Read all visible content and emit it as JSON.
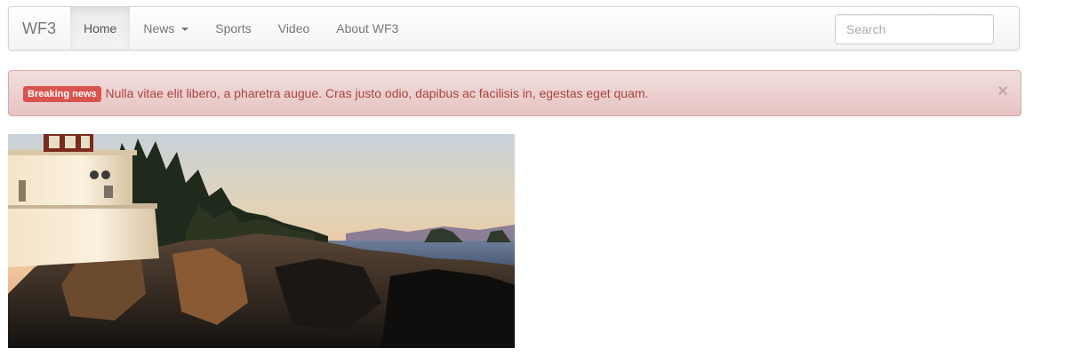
{
  "navbar": {
    "brand": "WF3",
    "items": [
      {
        "label": "Home",
        "active": true
      },
      {
        "label": "News",
        "dropdown": true
      },
      {
        "label": "Sports"
      },
      {
        "label": "Video"
      },
      {
        "label": "About WF3"
      }
    ],
    "search": {
      "placeholder": "Search",
      "value": ""
    }
  },
  "alert": {
    "badge": "Breaking news",
    "message": "Nulla vitae elit libero, a pharetra augue. Cras justo odio, dapibus ac facilisis in, egestas eget quam.",
    "close": "×"
  },
  "hero_image": {
    "subject": "lighthouse-on-rocky-coast-at-sunset"
  },
  "colors": {
    "alert_text": "#a94442",
    "badge_bg": "#d9534f",
    "nav_text": "#777777"
  }
}
